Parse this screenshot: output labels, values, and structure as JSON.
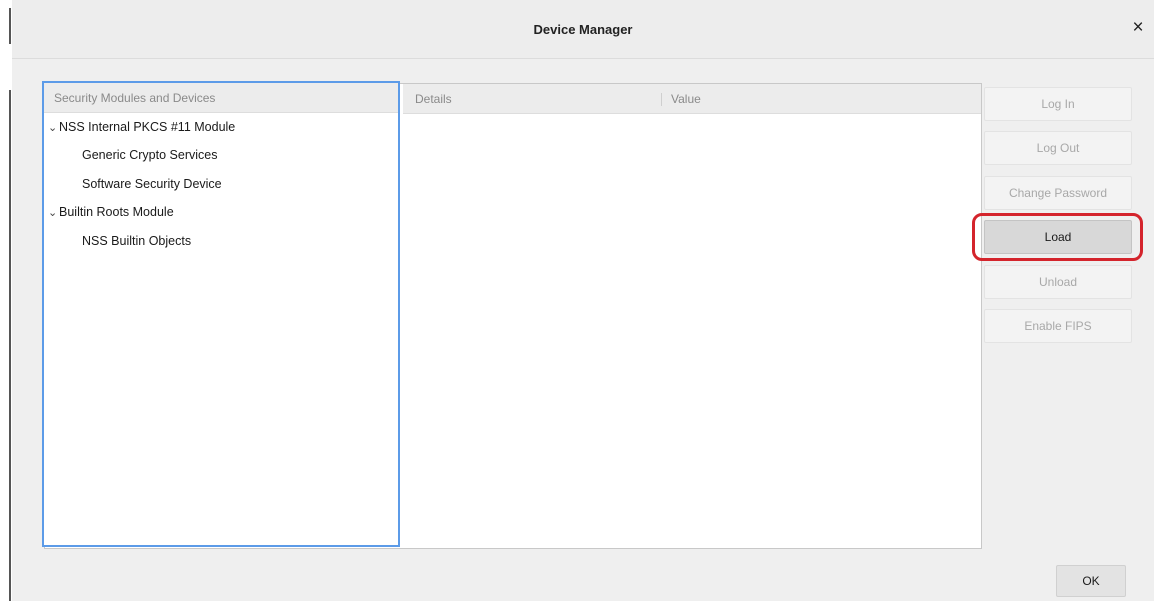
{
  "window": {
    "title": "Device Manager",
    "close_glyph": "×"
  },
  "tree": {
    "header": "Security Modules and Devices",
    "expand_glyph": "⌄",
    "items": [
      {
        "label": "NSS Internal PKCS #11 Module",
        "expanded": true
      },
      {
        "label": "Generic Crypto Services"
      },
      {
        "label": "Software Security Device"
      },
      {
        "label": "Builtin Roots Module",
        "expanded": true
      },
      {
        "label": "NSS Builtin Objects"
      }
    ]
  },
  "details": {
    "header_details": "Details",
    "header_value": "Value"
  },
  "buttons": {
    "log_in": "Log In",
    "log_out": "Log Out",
    "change_password": "Change Password",
    "load": "Load",
    "unload": "Unload",
    "enable_fips": "Enable FIPS",
    "ok": "OK"
  },
  "colors": {
    "focus_border": "#5c9be8",
    "highlight_ring": "#d4242c",
    "disabled_text": "#a8a8a8"
  }
}
